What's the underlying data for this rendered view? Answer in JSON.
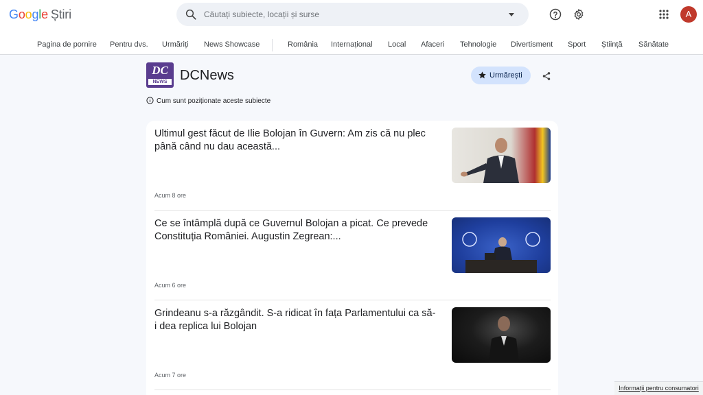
{
  "header": {
    "logo_google": [
      "G",
      "o",
      "o",
      "g",
      "l",
      "e"
    ],
    "logo_product": "Știri",
    "search_placeholder": "Căutați subiecte, locații și surse",
    "avatar_letter": "A",
    "icons": [
      "search-icon",
      "help-icon",
      "gear-icon",
      "apps-icon"
    ]
  },
  "nav": {
    "items": [
      "Pagina de pornire",
      "Pentru dvs.",
      "Urmăriți",
      "News Showcase",
      "România",
      "Internațional",
      "Local",
      "Afaceri",
      "Tehnologie",
      "Divertisment",
      "Sport",
      "Știință",
      "Sănătate"
    ]
  },
  "source": {
    "logo_text": "DC",
    "logo_sub": "NEWS",
    "name": "DCNews",
    "follow_label": "Urmărești",
    "info_text": "Cum sunt poziționate aceste subiecte"
  },
  "articles": [
    {
      "title": "Ultimul gest făcut de Ilie Bolojan în Guvern: Am zis că nu plec până când nu dau această...",
      "time": "Acum 8 ore"
    },
    {
      "title": "Ce se întâmplă după ce Guvernul Bolojan a picat. Ce prevede Constituția României. Augustin Zegrean:...",
      "time": "Acum 6 ore"
    },
    {
      "title": "Grindeanu s-a răzgândit. S-a ridicat în fața Parlamentului ca să-i dea replica lui Bolojan",
      "time": "Acum 7 ore"
    }
  ],
  "footer": {
    "consumer_link": "Informații pentru consumatori"
  },
  "colors": {
    "accent": "#d3e3fd",
    "avatar": "#c0392b",
    "source_logo": "#5a3d8f"
  }
}
